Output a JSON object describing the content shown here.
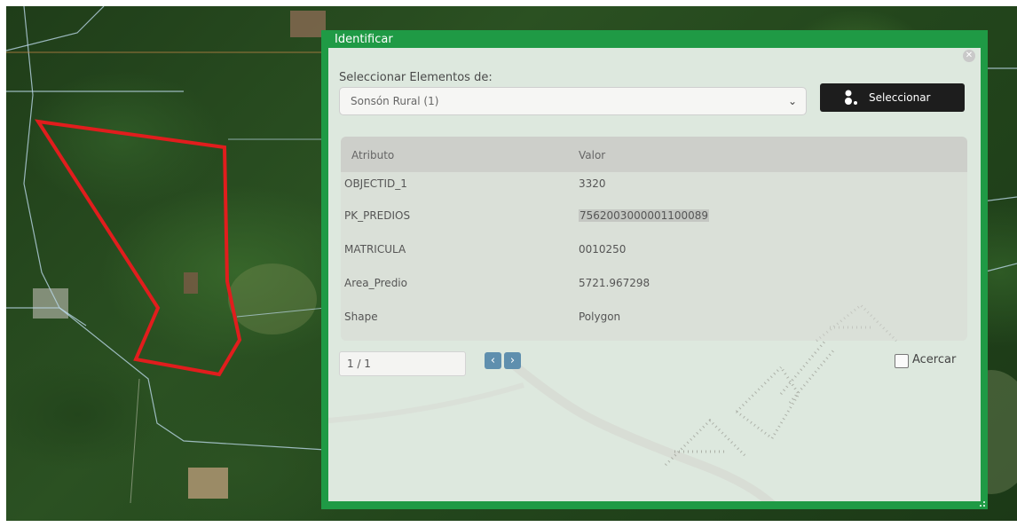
{
  "dialog": {
    "title": "Identificar",
    "close_icon": "close-icon",
    "select_label": "Seleccionar Elementos de:",
    "layer_value": "Sonsón Rural (1)",
    "select_button_label": "Seleccionar",
    "accent_color": "#1f9a45"
  },
  "table": {
    "headers": [
      "Atributo",
      "Valor"
    ],
    "rows": [
      {
        "attr": "OBJECTID_1",
        "value": "3320"
      },
      {
        "attr": "PK_PREDIOS",
        "value": "7562003000001100089"
      },
      {
        "attr": "MATRICULA",
        "value": "0010250"
      },
      {
        "attr": "Area_Predio",
        "value": "5721.967298"
      },
      {
        "attr": "Shape",
        "value": "Polygon"
      }
    ]
  },
  "pager": {
    "value": "1 / 1"
  },
  "zoom": {
    "label": "Acercar",
    "checked": false
  },
  "map": {
    "selection_color": "#e11d1d"
  }
}
